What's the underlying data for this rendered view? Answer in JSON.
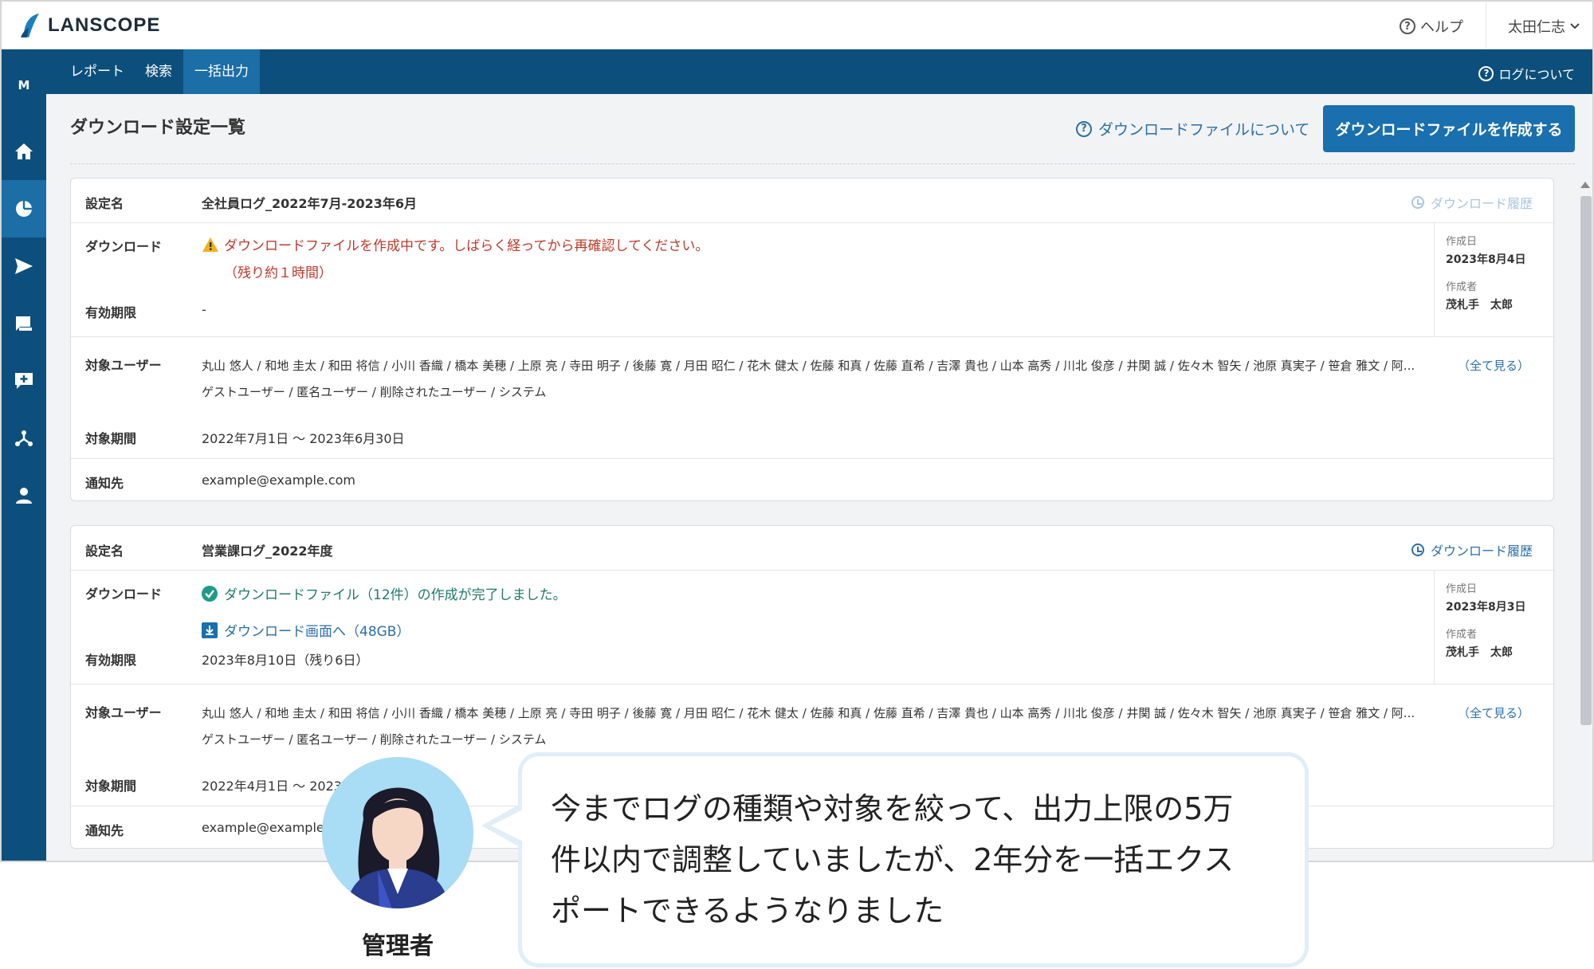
{
  "header": {
    "logo_text": "LANSCOPE",
    "help_label": "ヘルプ",
    "user_name": "太田仁志"
  },
  "sidenav": {
    "mode_letter": "M",
    "items": [
      {
        "icon": "home-icon"
      },
      {
        "icon": "pie-chart-icon",
        "active": true
      },
      {
        "icon": "send-icon"
      },
      {
        "icon": "chat-icon"
      },
      {
        "icon": "message-plus-icon"
      },
      {
        "icon": "network-icon"
      },
      {
        "icon": "user-icon"
      }
    ]
  },
  "tabs": [
    {
      "label": "レポート"
    },
    {
      "label": "検索"
    },
    {
      "label": "一括出力",
      "active": true
    }
  ],
  "log_about": "ログについて",
  "page": {
    "title": "ダウンロード設定一覧",
    "about_link": "ダウンロードファイルについて",
    "create_button": "ダウンロードファイルを作成する"
  },
  "labels": {
    "setting_name": "設定名",
    "download": "ダウンロード",
    "expiry": "有効期限",
    "target_users": "対象ユーザー",
    "target_period": "対象期間",
    "notify_to": "通知先",
    "created_date": "作成日",
    "creator": "作成者",
    "history": "ダウンロード履歴",
    "see_all": "（全て見る）"
  },
  "cards": [
    {
      "name": "全社員ログ_2022年7月-2023年6月",
      "status_line1": "ダウンロードファイルを作成中です。しばらく経ってから再確認してください。",
      "status_line2": "（残り約１時間）",
      "expiry": "-",
      "created_date": "2023年8月4日",
      "creator": "茂札手　太郎",
      "users_line1": "丸山 悠人 / 和地 圭太 / 和田 将信 / 小川 香織 / 橋本 美穂 / 上原 亮 / 寺田 明子 / 後藤 寛 / 月田 昭仁 / 花木 健太 / 佐藤 和真 / 佐藤 直希 / 吉澤 貴也 / 山本 高秀 / 川北 俊彦 / 井関 誠 / 佐々木 智矢 / 池原 真実子 / 笹倉 雅文 / 阿...",
      "users_line2": "ゲストユーザー / 匿名ユーザー / 削除されたユーザー / システム",
      "period": "2022年7月1日 ～ 2023年6月30日",
      "notify": "example@example.com"
    },
    {
      "name": "営業課ログ_2022年度",
      "status_line1": "ダウンロードファイル（12件）の作成が完了しました。",
      "download_link": "ダウンロード画面へ（48GB）",
      "expiry": "2023年8月10日（残り6日）",
      "created_date": "2023年8月3日",
      "creator": "茂札手　太郎",
      "users_line1": "丸山 悠人 / 和地 圭太 / 和田 将信 / 小川 香織 / 橋本 美穂 / 上原 亮 / 寺田 明子 / 後藤 寛 / 月田 昭仁 / 花木 健太 / 佐藤 和真 / 佐藤 直希 / 吉澤 貴也 / 山本 高秀 / 川北 俊彦 / 井関 誠 / 佐々木 智矢 / 池原 真実子 / 笹倉 雅文 / 阿...",
      "users_line2": "ゲストユーザー / 匿名ユーザー / 削除されたユーザー / システム",
      "period": "2022年4月1日 ～ 2023",
      "notify": "example@example"
    }
  ],
  "overlay": {
    "role": "管理者",
    "bubble_line1": "今までログの種類や対象を絞って、出力上限の5万",
    "bubble_line2": "件以内で調整していましたが、2年分を一括エクス",
    "bubble_line3": "ポートできるようなりました"
  },
  "colors": {
    "nav": "#0d4f7c",
    "nav_active": "#1b6ea6",
    "primary": "#1a6fae",
    "link": "#2b6fa8",
    "warning": "#c0392b",
    "success": "#1f7a6b"
  }
}
